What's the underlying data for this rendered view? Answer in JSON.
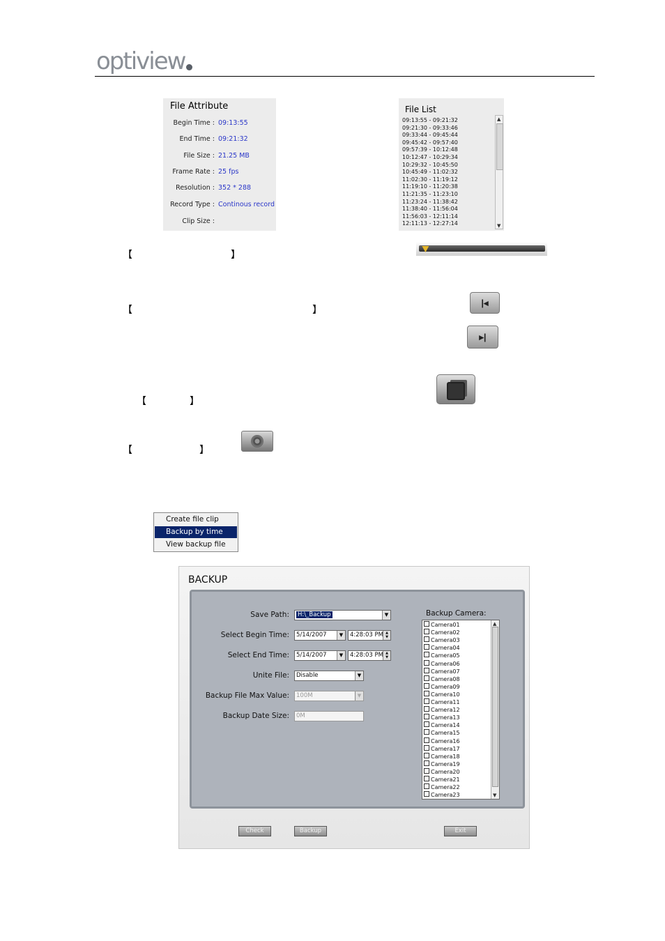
{
  "header": {
    "logo_text": "optiview",
    "logo_mark": "®"
  },
  "file_attribute": {
    "title": "File Attribute",
    "rows": [
      {
        "label": "Begin Time :",
        "value": "09:13:55"
      },
      {
        "label": "End Time :",
        "value": "09:21:32"
      },
      {
        "label": "File Size :",
        "value": "21.25 MB"
      },
      {
        "label": "Frame Rate :",
        "value": "25 fps"
      },
      {
        "label": "Resolution :",
        "value": "352 * 288"
      },
      {
        "label": "Record Type :",
        "value": "Continous record"
      },
      {
        "label": "Clip Size :",
        "value": ""
      }
    ]
  },
  "file_list": {
    "title": "File List",
    "items": [
      "09:13:55 - 09:21:32",
      "09:21:30 - 09:33:46",
      "09:33:44 - 09:45:44",
      "09:45:42 - 09:57:40",
      "09:57:39 - 10:12:48",
      "10:12:47 - 10:29:34",
      "10:29:32 - 10:45:50",
      "10:45:49 - 11:02:32",
      "11:02:30 - 11:19:12",
      "11:19:10 - 11:20:38",
      "11:21:35 - 11:23:10",
      "11:23:24 - 11:38:42",
      "11:38:40 - 11:56:04",
      "11:56:03 - 12:11:14",
      "12:11:13 - 12:27:14"
    ]
  },
  "brackets": {
    "open": "【",
    "close": "】"
  },
  "slider": {
    "position": 0.02
  },
  "context_menu": {
    "items": [
      "Create file clip",
      "Backup by time",
      "View backup file"
    ],
    "selected_index": 1
  },
  "backup_dialog": {
    "title": "BACKUP",
    "save_path_label": "Save Path:",
    "save_path_value": "H:\\_Backup",
    "begin_time_label": "Select Begin Time:",
    "begin_date": "5/14/2007",
    "begin_time": "4:28:03 PM",
    "end_time_label": "Select End Time:",
    "end_date": "5/14/2007",
    "end_time": "4:28:03 PM",
    "unite_file_label": "Unite File:",
    "unite_file_value": "Disable",
    "max_value_label": "Backup File Max Value:",
    "max_value": "100M",
    "date_size_label": "Backup Date Size:",
    "date_size_value": "0M",
    "camera_label": "Backup Camera:",
    "cameras": [
      "Camera01",
      "Camera02",
      "Camera03",
      "Camera04",
      "Camera05",
      "Camera06",
      "Camera07",
      "Camera08",
      "Camera09",
      "Camera10",
      "Camera11",
      "Camera12",
      "Camera13",
      "Camera14",
      "Camera15",
      "Camera16",
      "Camera17",
      "Camera18",
      "Camera19",
      "Camera20",
      "Camera21",
      "Camera22",
      "Camera23"
    ],
    "buttons": {
      "check": "Check",
      "backup": "Backup",
      "exit": "Exit"
    }
  }
}
